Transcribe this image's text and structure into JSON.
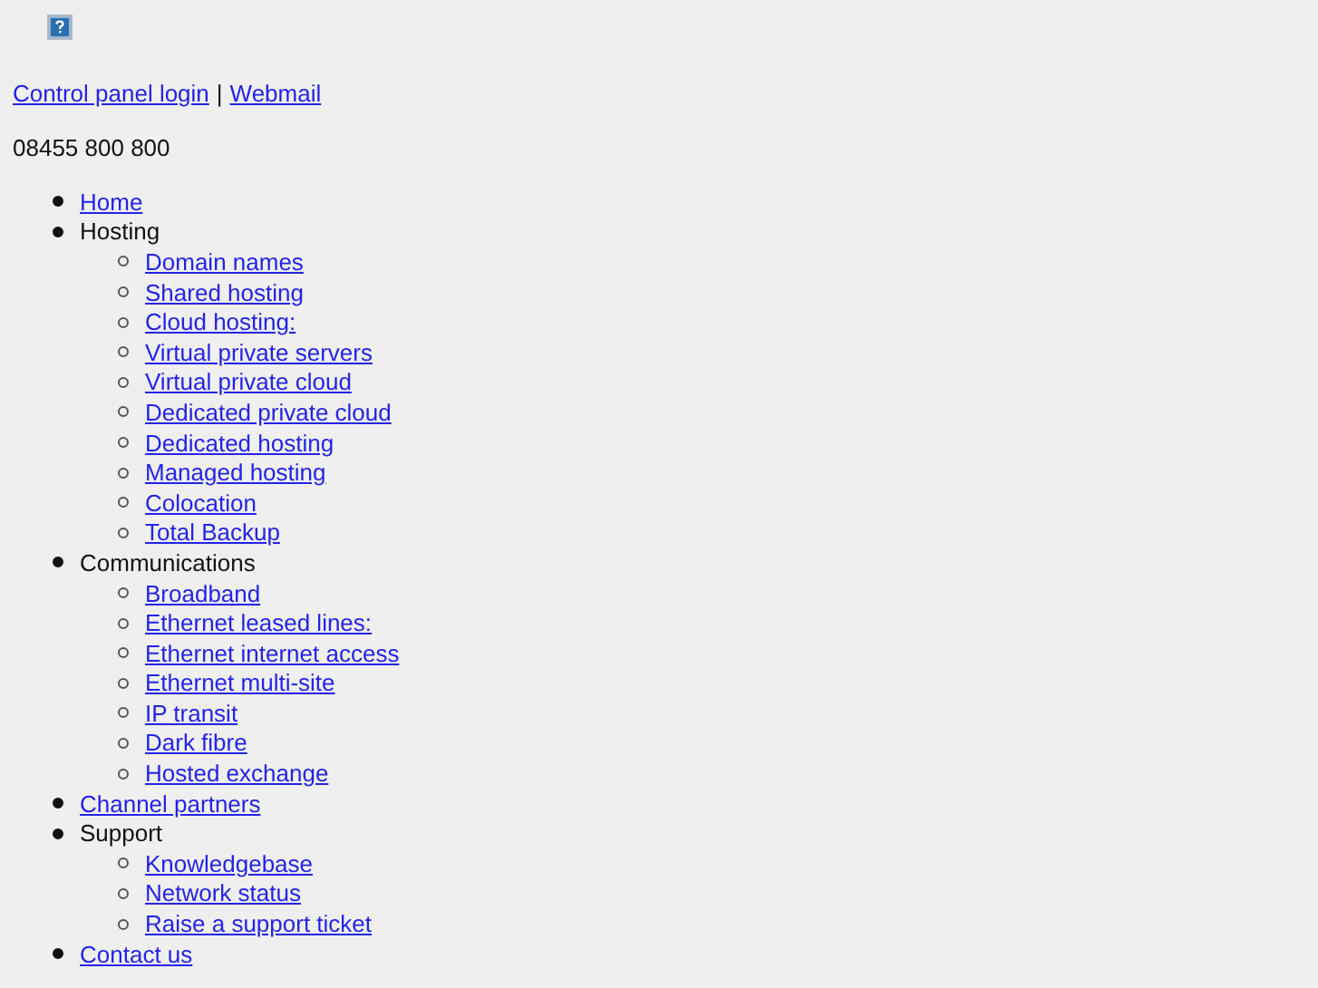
{
  "top_links": [
    {
      "label": "Control panel login"
    },
    {
      "label": "Webmail"
    }
  ],
  "separator": "|",
  "phone": "08455 800 800",
  "nav": [
    {
      "label": "Home",
      "kind": "link"
    },
    {
      "label": "Hosting",
      "kind": "text",
      "children": [
        {
          "label": "Domain names",
          "kind": "link"
        },
        {
          "label": "Shared hosting",
          "kind": "link"
        },
        {
          "label": "Cloud hosting:",
          "kind": "link"
        },
        {
          "label": "Virtual private servers",
          "kind": "link"
        },
        {
          "label": "Virtual private cloud",
          "kind": "link"
        },
        {
          "label": "Dedicated private cloud",
          "kind": "link"
        },
        {
          "label": "Dedicated hosting",
          "kind": "link"
        },
        {
          "label": "Managed hosting",
          "kind": "link"
        },
        {
          "label": "Colocation",
          "kind": "link"
        },
        {
          "label": "Total Backup",
          "kind": "link"
        }
      ]
    },
    {
      "label": "Communications",
      "kind": "text",
      "children": [
        {
          "label": "Broadband",
          "kind": "link"
        },
        {
          "label": "Ethernet leased lines:",
          "kind": "link"
        },
        {
          "label": "Ethernet internet access",
          "kind": "link"
        },
        {
          "label": "Ethernet multi-site",
          "kind": "link"
        },
        {
          "label": "IP transit",
          "kind": "link"
        },
        {
          "label": "Dark fibre",
          "kind": "link"
        },
        {
          "label": "Hosted exchange",
          "kind": "link"
        }
      ]
    },
    {
      "label": "Channel partners",
      "kind": "link"
    },
    {
      "label": "Support",
      "kind": "text",
      "children": [
        {
          "label": "Knowledgebase",
          "kind": "link"
        },
        {
          "label": "Network status",
          "kind": "link"
        },
        {
          "label": "Raise a support ticket",
          "kind": "link"
        }
      ]
    },
    {
      "label": "Contact us",
      "kind": "link"
    }
  ]
}
